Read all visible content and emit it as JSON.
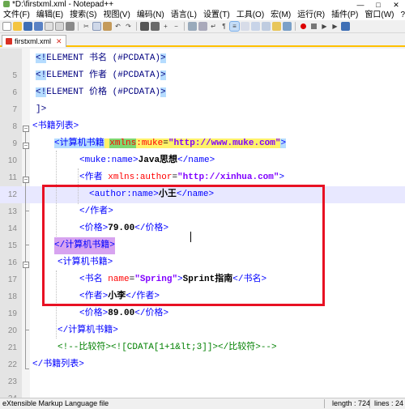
{
  "window": {
    "title": "*D:\\firstxml.xml - Notepad++",
    "minimize": "—",
    "maximize": "□",
    "close": "✕"
  },
  "menu": {
    "items": [
      "文件(F)",
      "编辑(E)",
      "搜索(S)",
      "视图(V)",
      "编码(N)",
      "语言(L)",
      "设置(T)",
      "工具(O)",
      "宏(M)",
      "运行(R)",
      "插件(P)",
      "窗口(W)",
      "?"
    ],
    "close_label": "X"
  },
  "toolbar": {
    "icons": [
      "new-file-icon",
      "open-file-icon",
      "save-icon",
      "save-all-icon",
      "close-icon",
      "close-all-icon",
      "print-icon",
      "cut-icon",
      "copy-icon",
      "paste-icon",
      "undo-icon",
      "redo-icon",
      "find-icon",
      "replace-icon",
      "zoom-in-icon",
      "zoom-out-icon",
      "sync-v-icon",
      "sync-h-icon",
      "word-wrap-icon",
      "show-all-icon",
      "indent-guide-icon",
      "lang-icon",
      "doc-map-icon",
      "function-list-icon",
      "folder-icon",
      "monitor-icon",
      "record-icon",
      "stop-icon",
      "play-icon",
      "play-multi-icon",
      "save-macro-icon"
    ]
  },
  "tab": {
    "label": "firstxml.xml",
    "close": "✕"
  },
  "editor": {
    "line_numbers": [
      "5",
      "6",
      "7",
      "8",
      "9",
      "10",
      "11",
      "12",
      "13",
      "14",
      "15",
      "16",
      "17",
      "18",
      "19",
      "20",
      "21",
      "22",
      "23",
      "24"
    ],
    "lines": {
      "l5": {
        "lt": "<!",
        "kw": "ELEMENT",
        "rest": " 书名 (#PCDATA)",
        "gt": ">"
      },
      "l6": {
        "lt": "<!",
        "kw": "ELEMENT",
        "rest": " 作者 (#PCDATA)",
        "gt": ">"
      },
      "l7": {
        "lt": "<!",
        "kw": "ELEMENT",
        "rest": " 价格 (#PCDATA)",
        "gt": ">"
      },
      "l8": {
        "close": "]>"
      },
      "l9": {
        "open": "<",
        "tag": "书籍列表",
        "end": ">"
      },
      "l10": {
        "open": "<",
        "tag": "计算机书籍",
        "sp": " ",
        "attr_ns": "xmlns",
        "attr_rest": ":muke",
        "eq": "=",
        "val": "\"http://www.muke.com\"",
        "end": ">"
      },
      "l11": {
        "open": "<",
        "tag": "muke:name",
        "end": ">",
        "text": "Java思想",
        "close_open": "</",
        "close_tag": "name",
        "close_end": ">"
      },
      "l12": {
        "open": "<",
        "tag": "作者",
        "sp": " ",
        "attr": "xmlns:author",
        "eq": "=",
        "val": "\"http://xinhua.com\"",
        "end": ">"
      },
      "l13": {
        "open": "<",
        "tag": "author:name",
        "end": ">",
        "text": "小王",
        "close_open": "</",
        "close_tag": "name",
        "close_end": ">"
      },
      "l14": {
        "open": "</",
        "tag": "作者",
        "end": ">"
      },
      "l15": {
        "open": "<",
        "tag": "价格",
        "end": ">",
        "text": "79.00",
        "close_open": "</",
        "close_tag": "价格",
        "close_end": ">"
      },
      "l16": {
        "open": "</",
        "tag": "计算机书籍",
        "end": ">"
      },
      "l17": {
        "open": "<",
        "tag": "计算机书籍",
        "end": ">"
      },
      "l18": {
        "open": "<",
        "tag": "书名",
        "sp": " ",
        "attr": "name",
        "eq": "=",
        "val": "\"Spring\"",
        "end": ">",
        "text": "Sprint指南",
        "close_open": "</",
        "close_tag": "书名",
        "close_end": ">"
      },
      "l19": {
        "open": "<",
        "tag": "作者",
        "end": ">",
        "text": "小李",
        "close_open": "</",
        "close_tag": "作者",
        "close_end": ">"
      },
      "l20": {
        "open": "<",
        "tag": "价格",
        "end": ">",
        "text": "89.00",
        "close_open": "</",
        "close_tag": "价格",
        "close_end": ">"
      },
      "l21": {
        "open": "</",
        "tag": "计算机书籍",
        "end": ">"
      },
      "l22": {
        "comment": "<!--比较符><![CDATA[1+1&lt;3]]></比较符>-->"
      },
      "l23": {
        "open": "</",
        "tag": "书籍列表",
        "end": ">"
      }
    }
  },
  "status": {
    "language": "eXtensible Markup Language file",
    "length": "length : 724",
    "lines": "lines : 24"
  },
  "colors": {
    "annotation_box": "#e81123",
    "tab_underline": "#ffc000",
    "current_line": "#e8e8ff"
  }
}
